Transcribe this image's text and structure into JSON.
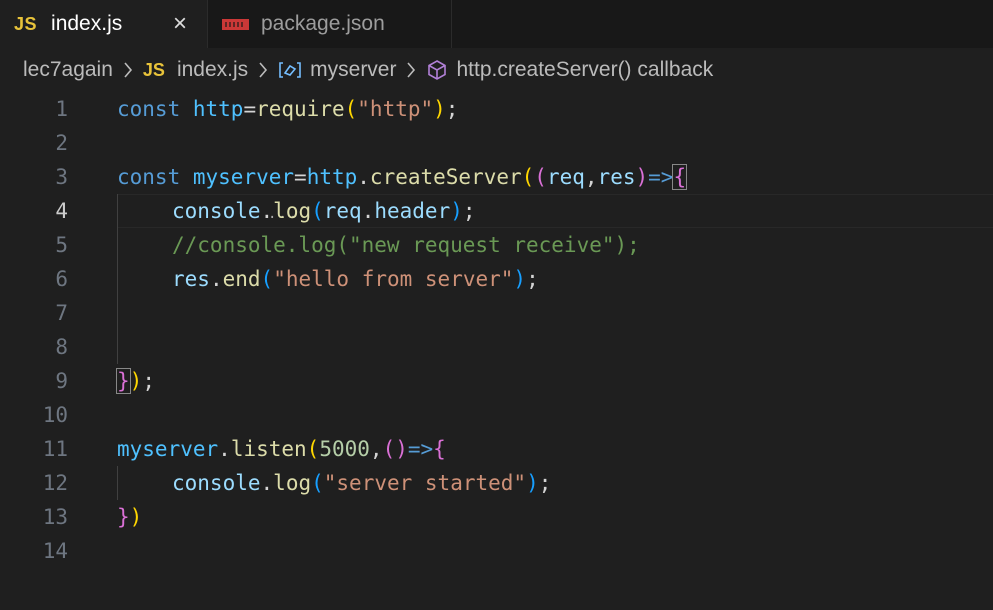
{
  "tabs": [
    {
      "badge": "JS",
      "label": "index.js",
      "active": true,
      "close": "×"
    },
    {
      "label": "package.json",
      "active": false
    }
  ],
  "breadcrumb": {
    "folder": "lec7again",
    "file_badge": "JS",
    "file": "index.js",
    "symbol1": "myserver",
    "symbol2": "http.createServer() callback"
  },
  "editor": {
    "current_line": 4,
    "line_numbers": [
      "1",
      "2",
      "3",
      "4",
      "5",
      "6",
      "7",
      "8",
      "9",
      "10",
      "11",
      "12",
      "13",
      "14"
    ],
    "tokens": {
      "l1": [
        "const",
        "http",
        "=",
        "require",
        "(",
        "\"http\"",
        ")",
        ";"
      ],
      "l3": [
        "const",
        "myserver",
        "=",
        "http",
        ".",
        "createServer",
        "(",
        "(",
        "req",
        ",",
        "res",
        ")",
        "=>",
        "{"
      ],
      "l4": [
        "console",
        ".",
        "log",
        "(",
        "req",
        ".",
        "header",
        ")",
        ";"
      ],
      "l5": [
        "//console.log(\"new request receive\");"
      ],
      "l6": [
        "res",
        ".",
        "end",
        "(",
        "\"hello from server\"",
        ")",
        ";"
      ],
      "l9": [
        "}",
        ")",
        ";"
      ],
      "l11": [
        "myserver",
        ".",
        "listen",
        "(",
        "5000",
        ",",
        "(",
        ")",
        "=>",
        "{"
      ],
      "l12": [
        "console",
        ".",
        "log",
        "(",
        "\"server started\"",
        ")",
        ";"
      ],
      "l13": [
        "}",
        ")"
      ]
    }
  },
  "colors": {
    "background": "#1f1f1f",
    "keyword": "#569cd6",
    "variable": "#4fc1ff",
    "function": "#dcdcaa",
    "string": "#ce9178",
    "comment": "#6a9955",
    "js_badge": "#e8c33a"
  }
}
